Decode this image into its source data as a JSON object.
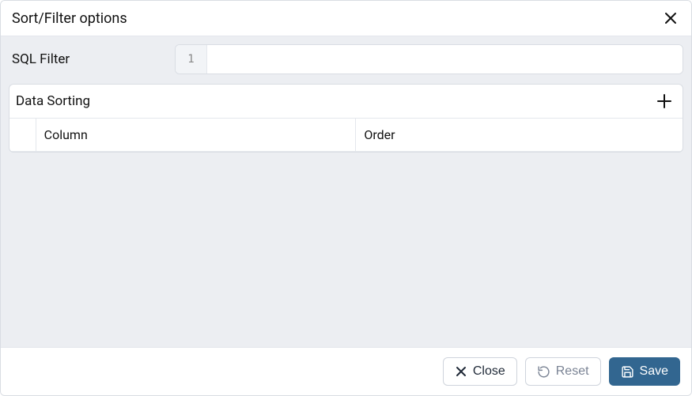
{
  "dialog": {
    "title": "Sort/Filter options"
  },
  "sql": {
    "label": "SQL Filter",
    "line_number": "1",
    "value": ""
  },
  "sorting": {
    "title": "Data Sorting",
    "columns": {
      "column": "Column",
      "order": "Order"
    },
    "rows": []
  },
  "footer": {
    "close_label": "Close",
    "reset_label": "Reset",
    "save_label": "Save"
  }
}
